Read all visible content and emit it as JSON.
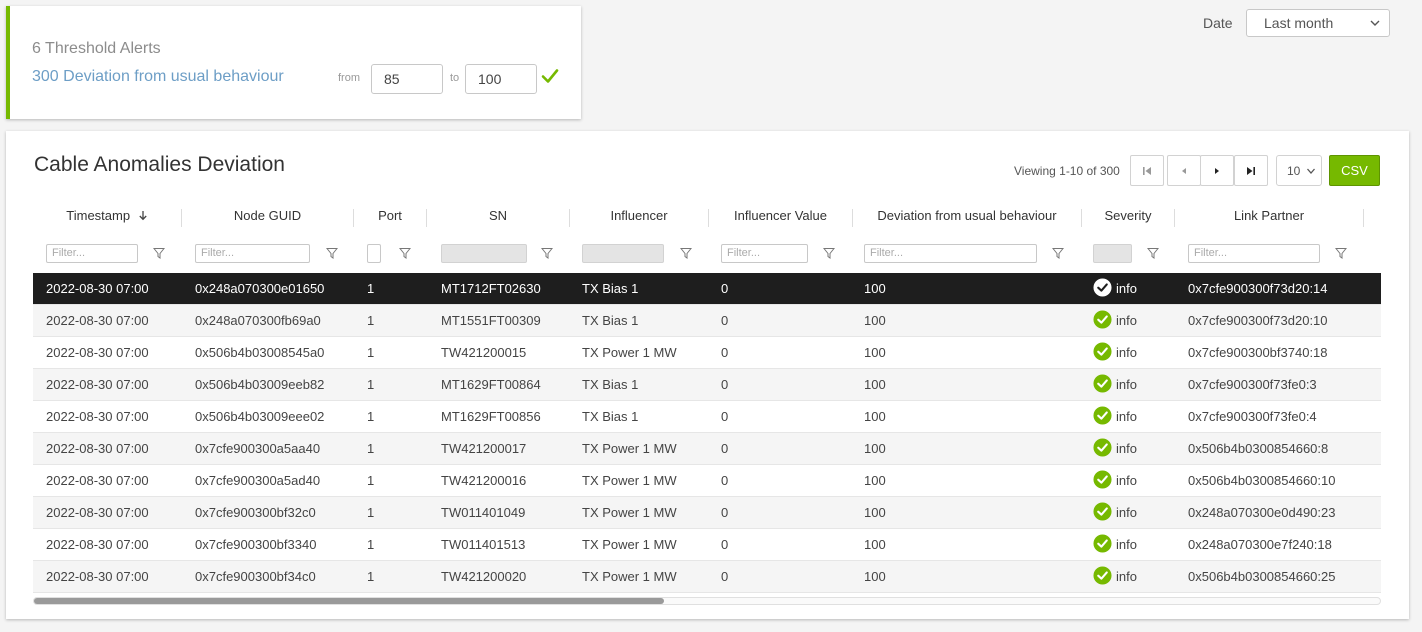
{
  "alerts": {
    "title": "6 Threshold Alerts",
    "subtitle": "300 Deviation from usual behaviour",
    "from_label": "from",
    "from_value": "85",
    "to_label": "to",
    "to_value": "100"
  },
  "date_filter": {
    "label": "Date",
    "selected": "Last month"
  },
  "panel": {
    "title": "Cable Anomalies Deviation",
    "viewing": "Viewing 1-10 of 300",
    "per_page": "10",
    "csv_label": "CSV"
  },
  "colors": {
    "accent": "#76b900",
    "alert_link": "#6d9ec6",
    "selected_row": "#1e1e1e"
  },
  "table": {
    "columns": [
      {
        "key": "timestamp",
        "label": "Timestamp",
        "sort": "desc",
        "filter": "Filter..."
      },
      {
        "key": "node_guid",
        "label": "Node GUID",
        "filter": "Filter..."
      },
      {
        "key": "port",
        "label": "Port",
        "filter": ""
      },
      {
        "key": "sn",
        "label": "SN",
        "filter": ""
      },
      {
        "key": "influencer",
        "label": "Influencer",
        "filter": ""
      },
      {
        "key": "influencer_value",
        "label": "Influencer Value",
        "filter": "Filter..."
      },
      {
        "key": "deviation",
        "label": "Deviation from usual behaviour",
        "filter": "Filter..."
      },
      {
        "key": "severity",
        "label": "Severity",
        "filter": ""
      },
      {
        "key": "link_partner",
        "label": "Link Partner",
        "filter": "Filter..."
      }
    ],
    "rows": [
      {
        "timestamp": "2022-08-30 07:00",
        "node_guid": "0x248a070300e01650",
        "port": "1",
        "sn": "MT1712FT02630",
        "influencer": "TX Bias 1",
        "influencer_value": "0",
        "deviation": "100",
        "severity": "info",
        "link_partner": "0x7cfe900300f73d20:14"
      },
      {
        "timestamp": "2022-08-30 07:00",
        "node_guid": "0x248a070300fb69a0",
        "port": "1",
        "sn": "MT1551FT00309",
        "influencer": "TX Bias 1",
        "influencer_value": "0",
        "deviation": "100",
        "severity": "info",
        "link_partner": "0x7cfe900300f73d20:10"
      },
      {
        "timestamp": "2022-08-30 07:00",
        "node_guid": "0x506b4b03008545a0",
        "port": "1",
        "sn": "TW421200015",
        "influencer": "TX Power 1 MW",
        "influencer_value": "0",
        "deviation": "100",
        "severity": "info",
        "link_partner": "0x7cfe900300bf3740:18"
      },
      {
        "timestamp": "2022-08-30 07:00",
        "node_guid": "0x506b4b03009eeb82",
        "port": "1",
        "sn": "MT1629FT00864",
        "influencer": "TX Bias 1",
        "influencer_value": "0",
        "deviation": "100",
        "severity": "info",
        "link_partner": "0x7cfe900300f73fe0:3"
      },
      {
        "timestamp": "2022-08-30 07:00",
        "node_guid": "0x506b4b03009eee02",
        "port": "1",
        "sn": "MT1629FT00856",
        "influencer": "TX Bias 1",
        "influencer_value": "0",
        "deviation": "100",
        "severity": "info",
        "link_partner": "0x7cfe900300f73fe0:4"
      },
      {
        "timestamp": "2022-08-30 07:00",
        "node_guid": "0x7cfe900300a5aa40",
        "port": "1",
        "sn": "TW421200017",
        "influencer": "TX Power 1 MW",
        "influencer_value": "0",
        "deviation": "100",
        "severity": "info",
        "link_partner": "0x506b4b0300854660:8"
      },
      {
        "timestamp": "2022-08-30 07:00",
        "node_guid": "0x7cfe900300a5ad40",
        "port": "1",
        "sn": "TW421200016",
        "influencer": "TX Power 1 MW",
        "influencer_value": "0",
        "deviation": "100",
        "severity": "info",
        "link_partner": "0x506b4b0300854660:10"
      },
      {
        "timestamp": "2022-08-30 07:00",
        "node_guid": "0x7cfe900300bf32c0",
        "port": "1",
        "sn": "TW011401049",
        "influencer": "TX Power 1 MW",
        "influencer_value": "0",
        "deviation": "100",
        "severity": "info",
        "link_partner": "0x248a070300e0d490:23"
      },
      {
        "timestamp": "2022-08-30 07:00",
        "node_guid": "0x7cfe900300bf3340",
        "port": "1",
        "sn": "TW011401513",
        "influencer": "TX Power 1 MW",
        "influencer_value": "0",
        "deviation": "100",
        "severity": "info",
        "link_partner": "0x248a070300e7f240:18"
      },
      {
        "timestamp": "2022-08-30 07:00",
        "node_guid": "0x7cfe900300bf34c0",
        "port": "1",
        "sn": "TW421200020",
        "influencer": "TX Power 1 MW",
        "influencer_value": "0",
        "deviation": "100",
        "severity": "info",
        "link_partner": "0x506b4b0300854660:25"
      }
    ]
  },
  "icons": {
    "confirm": "check-icon",
    "severity_info": "check-circle-icon",
    "sort": "arrow-down-icon",
    "filter": "funnel-icon",
    "pagination": [
      "first-page-icon",
      "prev-page-icon",
      "next-page-icon",
      "last-page-icon"
    ]
  }
}
